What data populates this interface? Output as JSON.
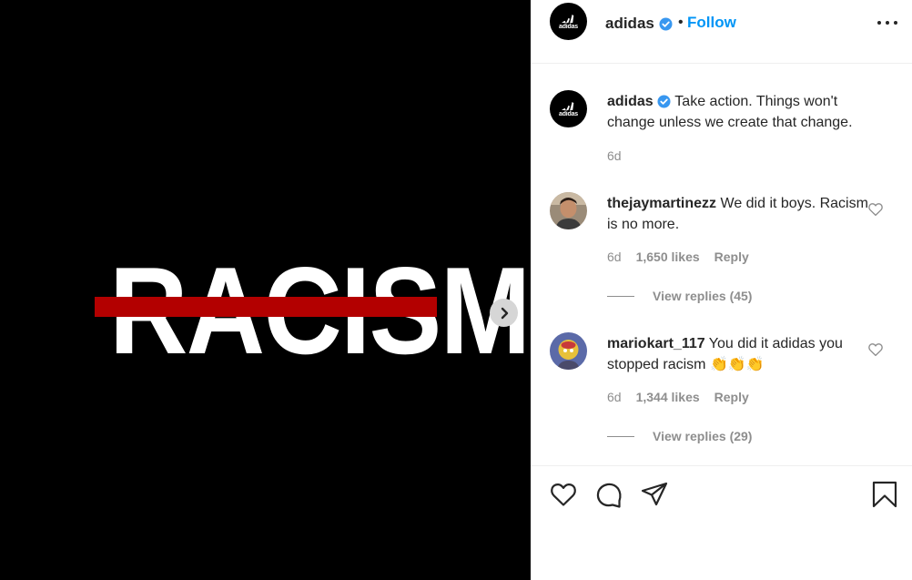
{
  "post": {
    "image_text": "RACISM",
    "strike_color": "#b30000",
    "next_icon": "chevron-right-icon"
  },
  "header": {
    "username": "adidas",
    "verified": true,
    "separator": "•",
    "follow_label": "Follow",
    "more_icon": "more-horizontal-icon"
  },
  "caption": {
    "username": "adidas",
    "text": "Take action. Things won't change unless we create that change.",
    "time": "6d"
  },
  "comments": [
    {
      "username": "thejaymartinezz",
      "text": "We did it boys. Racism is no more.",
      "time": "6d",
      "likes": "1,650 likes",
      "reply_label": "Reply",
      "view_replies": "View replies (45)"
    },
    {
      "username": "mariokart_117",
      "text": "You did it adidas you stopped racism",
      "emoji": "👏👏👏",
      "time": "6d",
      "likes": "1,344 likes",
      "reply_label": "Reply",
      "view_replies": "View replies (29)"
    }
  ],
  "actions": {
    "like_icon": "heart-icon",
    "comment_icon": "comment-icon",
    "share_icon": "paper-plane-icon",
    "save_icon": "bookmark-icon"
  },
  "colors": {
    "accent": "#0095f6",
    "verified": "#3897f0",
    "muted": "#8e8e8e",
    "text": "#262626"
  }
}
